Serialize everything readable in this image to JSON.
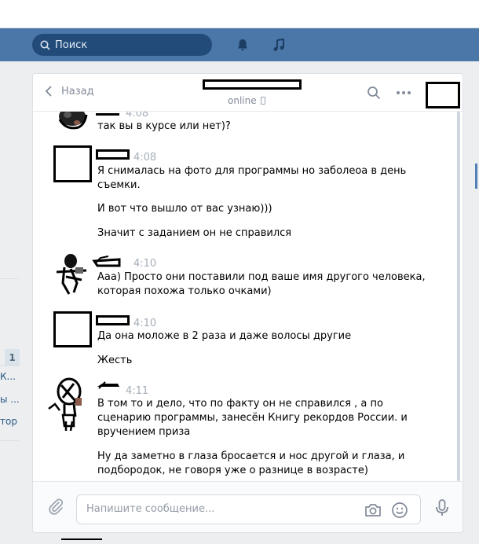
{
  "header": {
    "search_placeholder": "Поиск",
    "notifications_icon": "bell-icon",
    "music_icon": "music-note-icon"
  },
  "left_column": {
    "badge": "1",
    "items": [
      "К...",
      "ы ...",
      "тор"
    ]
  },
  "chat_header": {
    "back_label": "Назад",
    "status": "online",
    "status_icon": "phone-icon",
    "search_icon": "search-icon",
    "more_icon": "more-dots-icon"
  },
  "messages": [
    {
      "time": "4:08",
      "lines": [
        "так вы в курсе или нет)?"
      ]
    },
    {
      "time": "4:08",
      "lines": [
        "Я снималась на фото для программы но заболеоа в день съемки.",
        "И вот что вышло от вас узнаю)))",
        "Значит с заданием он не справился"
      ]
    },
    {
      "time": "4:10",
      "lines": [
        "Ааа) Просто они поставили под ваше имя другого человека, которая похожа только очками)"
      ]
    },
    {
      "time": "4:10",
      "lines": [
        "Да она моложе в 2 раза и даже волосы другие",
        "Жесть"
      ]
    },
    {
      "time": "4:11",
      "lines": [
        "В том то и дело, что по факту он не справился , а по сценарию программы, занесён Книгу рекордов России. и вручением приза",
        "Ну да заметно в глаза бросается и нос другой и глаза, и подбородок, не говоря уже о разнице в возрасте)"
      ]
    }
  ],
  "composer": {
    "placeholder": "Напишите сообщение...",
    "value": "",
    "attach_icon": "paperclip-icon",
    "camera_icon": "camera-icon",
    "emoji_icon": "smile-icon",
    "voice_icon": "microphone-icon"
  },
  "colors": {
    "header_bg": "#4a76a8",
    "search_bg": "#224b7a",
    "page_bg": "#edeef0",
    "muted_text": "#828a99",
    "time_text": "#a5adb8"
  }
}
